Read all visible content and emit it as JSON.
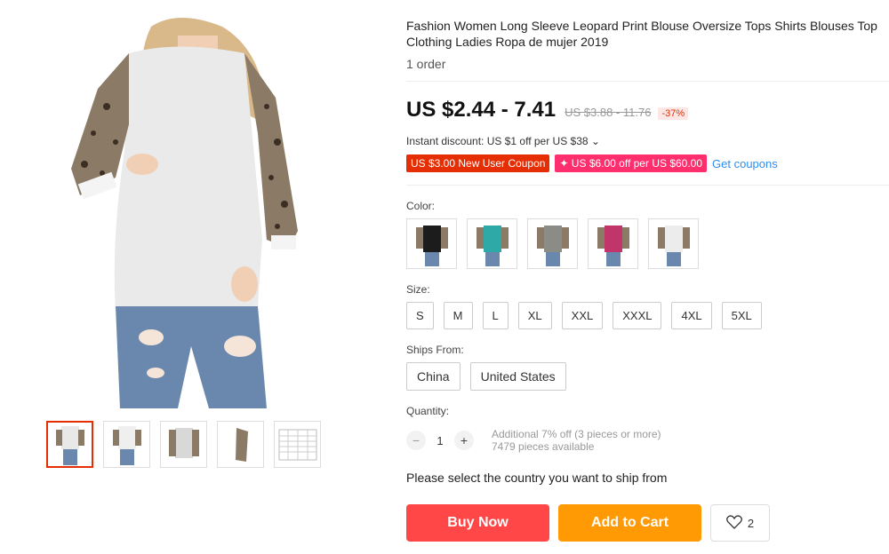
{
  "product": {
    "title": "Fashion Women Long Sleeve Leopard Print Blouse Oversize Tops Shirts Blouses Top Clothing Ladies Ropa de mujer 2019",
    "orders": "1 order"
  },
  "price": {
    "current": "US $2.44 - 7.41",
    "original": "US $3.88 - 11.76",
    "discount": "-37%",
    "instant_discount": "Instant discount: US $1 off per US $38 ⌄"
  },
  "coupons": {
    "items": [
      "US $3.00 New User Coupon",
      "✦ US $6.00 off per US $60.00"
    ],
    "get_label": "Get coupons"
  },
  "color": {
    "label": "Color:",
    "swatches": [
      {
        "name": "black",
        "hex": "#1c1c1c"
      },
      {
        "name": "teal",
        "hex": "#2ea9a8"
      },
      {
        "name": "gray",
        "hex": "#8c8c86"
      },
      {
        "name": "rose",
        "hex": "#c2356a"
      },
      {
        "name": "white",
        "hex": "#ececec"
      }
    ]
  },
  "size": {
    "label": "Size:",
    "options": [
      "S",
      "M",
      "L",
      "XL",
      "XXL",
      "XXXL",
      "4XL",
      "5XL"
    ]
  },
  "ships_from": {
    "label": "Ships From:",
    "options": [
      "China",
      "United States"
    ]
  },
  "quantity": {
    "label": "Quantity:",
    "value": "1",
    "minus": "−",
    "plus": "+",
    "note_line1": "Additional 7% off (3 pieces or more)",
    "note_line2": "7479 pieces available"
  },
  "ship_prompt": "Please select the country you want to ship from",
  "actions": {
    "buy_now": "Buy Now",
    "add_to_cart": "Add to Cart",
    "wishlist_count": "2"
  },
  "icons": {
    "wishlist": "heart-icon"
  },
  "colors": {
    "buy": "#ff4747",
    "cart": "#ff9a05",
    "accent_red": "#e62e04",
    "link_blue": "#2e8ff0"
  }
}
